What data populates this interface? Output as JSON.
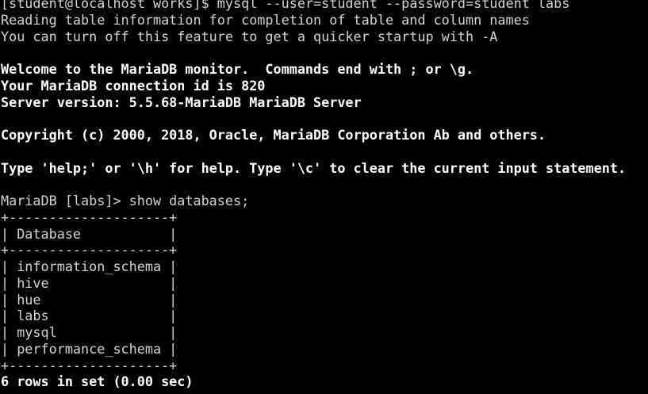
{
  "terminal": {
    "lines": [
      {
        "text": "[student@localhost works]$ mysql --user=student --password=student labs",
        "bold": false
      },
      {
        "text": "Reading table information for completion of table and column names",
        "bold": false
      },
      {
        "text": "You can turn off this feature to get a quicker startup with -A",
        "bold": false
      },
      {
        "text": "",
        "bold": false
      },
      {
        "text": "Welcome to the MariaDB monitor.  Commands end with ; or \\g.",
        "bold": true
      },
      {
        "text": "Your MariaDB connection id is 820",
        "bold": true
      },
      {
        "text": "Server version: 5.5.68-MariaDB MariaDB Server",
        "bold": true
      },
      {
        "text": "",
        "bold": false
      },
      {
        "text": "Copyright (c) 2000, 2018, Oracle, MariaDB Corporation Ab and others.",
        "bold": true
      },
      {
        "text": "",
        "bold": false
      },
      {
        "text": "Type 'help;' or '\\h' for help. Type '\\c' to clear the current input statement.",
        "bold": true
      },
      {
        "text": "",
        "bold": false
      },
      {
        "text": "MariaDB [labs]> show databases;",
        "bold": false
      },
      {
        "text": "+--------------------+",
        "bold": false
      },
      {
        "text": "| Database           |",
        "bold": false
      },
      {
        "text": "+--------------------+",
        "bold": false
      },
      {
        "text": "| information_schema |",
        "bold": false
      },
      {
        "text": "| hive               |",
        "bold": false
      },
      {
        "text": "| hue                |",
        "bold": false
      },
      {
        "text": "| labs               |",
        "bold": false
      },
      {
        "text": "| mysql              |",
        "bold": false
      },
      {
        "text": "| performance_schema |",
        "bold": false
      },
      {
        "text": "+--------------------+",
        "bold": false
      },
      {
        "text": "6 rows in set (0.00 sec)",
        "bold": true
      }
    ]
  },
  "colors": {
    "background": "#000000",
    "text": "#d3d3d3",
    "bold_text": "#ffffff"
  }
}
